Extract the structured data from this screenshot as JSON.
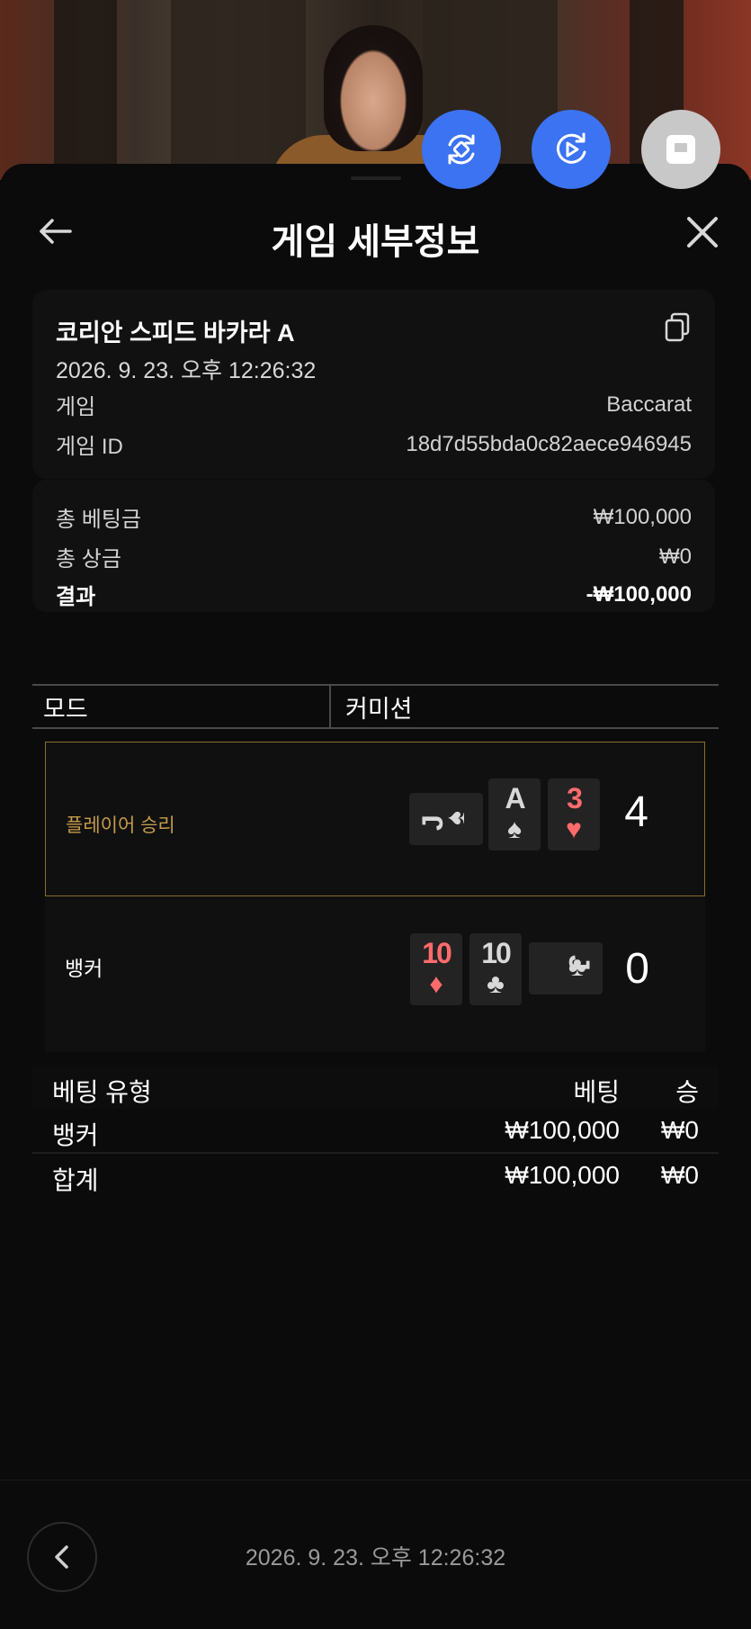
{
  "header": {
    "title": "게임 세부정보"
  },
  "game": {
    "table_name": "코리안 스피드 바카라 A",
    "datetime": "2026. 9. 23. 오후 12:26:32",
    "game_label": "게임",
    "game_value": "Baccarat",
    "game_id_label": "게임 ID",
    "game_id_value": "18d7d55bda0c82aece946945"
  },
  "totals": {
    "total_bet_label": "총 베팅금",
    "total_bet_value": "₩100,000",
    "total_win_label": "총 상금",
    "total_win_value": "₩0",
    "result_label": "결과",
    "result_value": "-₩100,000"
  },
  "tabs": {
    "mode": "모드",
    "commission": "커미션"
  },
  "hands": {
    "player": {
      "label": "플레이어 승리",
      "score": "4",
      "cards": [
        {
          "rank": "J",
          "suit": "♠",
          "color": "white",
          "orientation": "horizontal"
        },
        {
          "rank": "A",
          "suit": "♠",
          "color": "white",
          "orientation": "vertical"
        },
        {
          "rank": "3",
          "suit": "♥",
          "color": "red",
          "orientation": "vertical"
        }
      ]
    },
    "banker": {
      "label": "뱅커",
      "score": "0",
      "cards": [
        {
          "rank": "10",
          "suit": "♦",
          "color": "red",
          "orientation": "vertical"
        },
        {
          "rank": "10",
          "suit": "♣",
          "color": "white",
          "orientation": "vertical"
        },
        {
          "rank": "J",
          "suit": "♣",
          "color": "white",
          "orientation": "horizontal"
        }
      ]
    }
  },
  "bets": {
    "headers": {
      "type": "베팅 유형",
      "bet": "베팅",
      "win": "승"
    },
    "rows": [
      {
        "type": "뱅커",
        "bet": "₩100,000",
        "win": "₩0"
      }
    ],
    "total": {
      "type": "합계",
      "bet": "₩100,000",
      "win": "₩0"
    }
  },
  "footer": {
    "datetime": "2026. 9. 23. 오후 12:26:32"
  },
  "colors": {
    "accent_blue": "#3b73f2",
    "win_gold": "#c59a4c",
    "red_suit": "#ff6b6b"
  },
  "icons": {
    "fab1": "rotate-screen-icon",
    "fab2": "replay-video-icon",
    "fab3": "stop-video-icon",
    "back": "arrow-left-icon",
    "close": "close-icon",
    "copy": "copy-icon",
    "prev": "chevron-left-icon"
  }
}
